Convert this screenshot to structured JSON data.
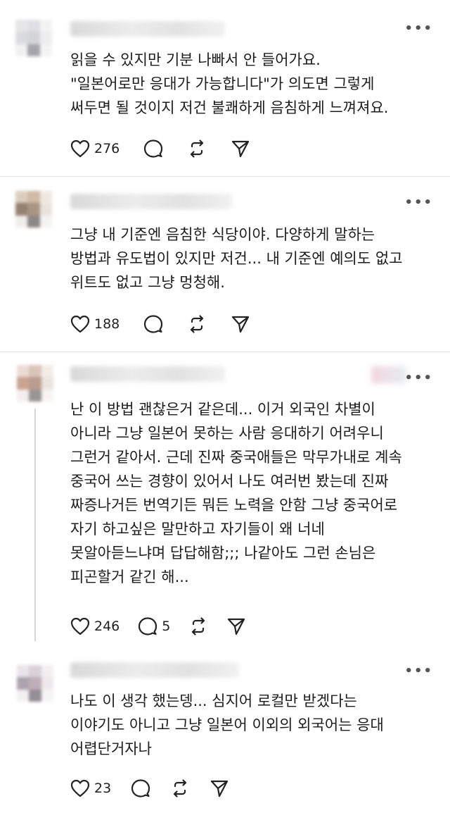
{
  "posts": [
    {
      "text": "읽을 수 있지만 기분 나빠서 안 들어가요.\n\"일본어로만 응대가 가능합니다\"가 의도면 그렇게\n써두면 될 것이지 저건 불쾌하게 음침하게 느껴져요.",
      "likes": "276",
      "replies": ""
    },
    {
      "text": "그냥 내 기준엔 음침한 식당이야. 다양하게 말하는\n방법과 유도법이 있지만 저건... 내 기준엔 예의도 없고\n위트도 없고 그냥 멍청해.",
      "likes": "188",
      "replies": ""
    },
    {
      "text": "난 이 방법 괜찮은거 같은데... 이거 외국인 차별이\n아니라 그냥 일본어 못하는 사람 응대하기 어려우니\n그런거 같아서. 근데 진짜 중국애들은 막무가내로 계속\n중국어 쓰는 경향이 있어서 나도 여러번 봤는데 진짜\n짜증나거든 번역기든 뭐든 노력을 안함 그냥 중국어로\n자기 하고싶은 말만하고 자기들이 왜 너네\n못알아듣느냐며 답답해함;;; 나같아도 그런 손님은\n피곤할거 같긴 해...",
      "likes": "246",
      "replies": "5"
    },
    {
      "text": "나도 이 생각 했는뎅... 심지어 로컬만 받겠다는\n이야기도 아니고 그냥 일본어 이외의 외국어는 응대\n어렵단거자나",
      "likes": "23",
      "replies": ""
    }
  ],
  "more_label": "•••",
  "icons": {
    "like": "heart-icon",
    "reply": "comment-icon",
    "repost": "repost-icon",
    "share": "send-icon"
  }
}
